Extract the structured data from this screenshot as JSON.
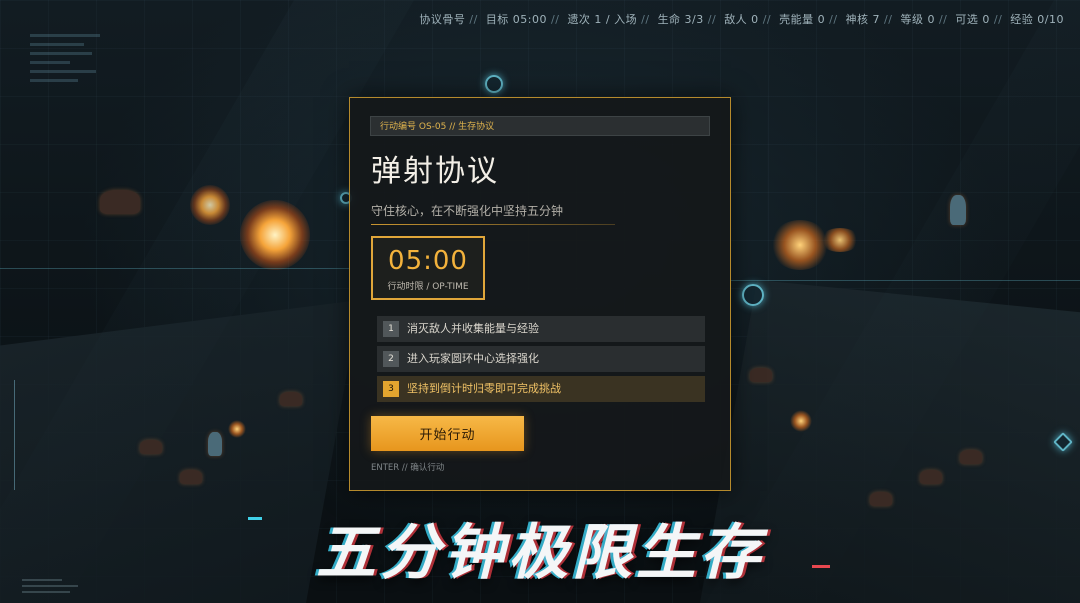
{
  "hud": {
    "status_items": [
      "协议骨号",
      "目标 05:00",
      "遗次 1 / 入场",
      "生命 3/3",
      "敌人 0",
      "壳能量 0",
      "神核 7",
      "等级 0",
      "可选 0",
      "经验 0/10"
    ]
  },
  "panel": {
    "op_code": "行动编号 OS-05 // 生存协议",
    "title": "弹射协议",
    "subtitle": "守住核心，在不断强化中坚持五分钟",
    "timer": {
      "value": "05:00",
      "label": "行动时限 / OP-TIME"
    },
    "objectives": [
      {
        "num": "1",
        "text": "消灭敌人并收集能量与经验"
      },
      {
        "num": "2",
        "text": "进入玩家圆环中心选择强化"
      },
      {
        "num": "3",
        "text": "坚持到倒计时归零即可完成挑战"
      }
    ],
    "start_label": "开始行动",
    "enter_hint": "ENTER // 确认行动"
  },
  "slogan": "五分钟极限生存",
  "colors": {
    "accent": "#e3a52f",
    "panel_border": "#b58a2c",
    "hud_cyan": "#5fb3c4"
  }
}
